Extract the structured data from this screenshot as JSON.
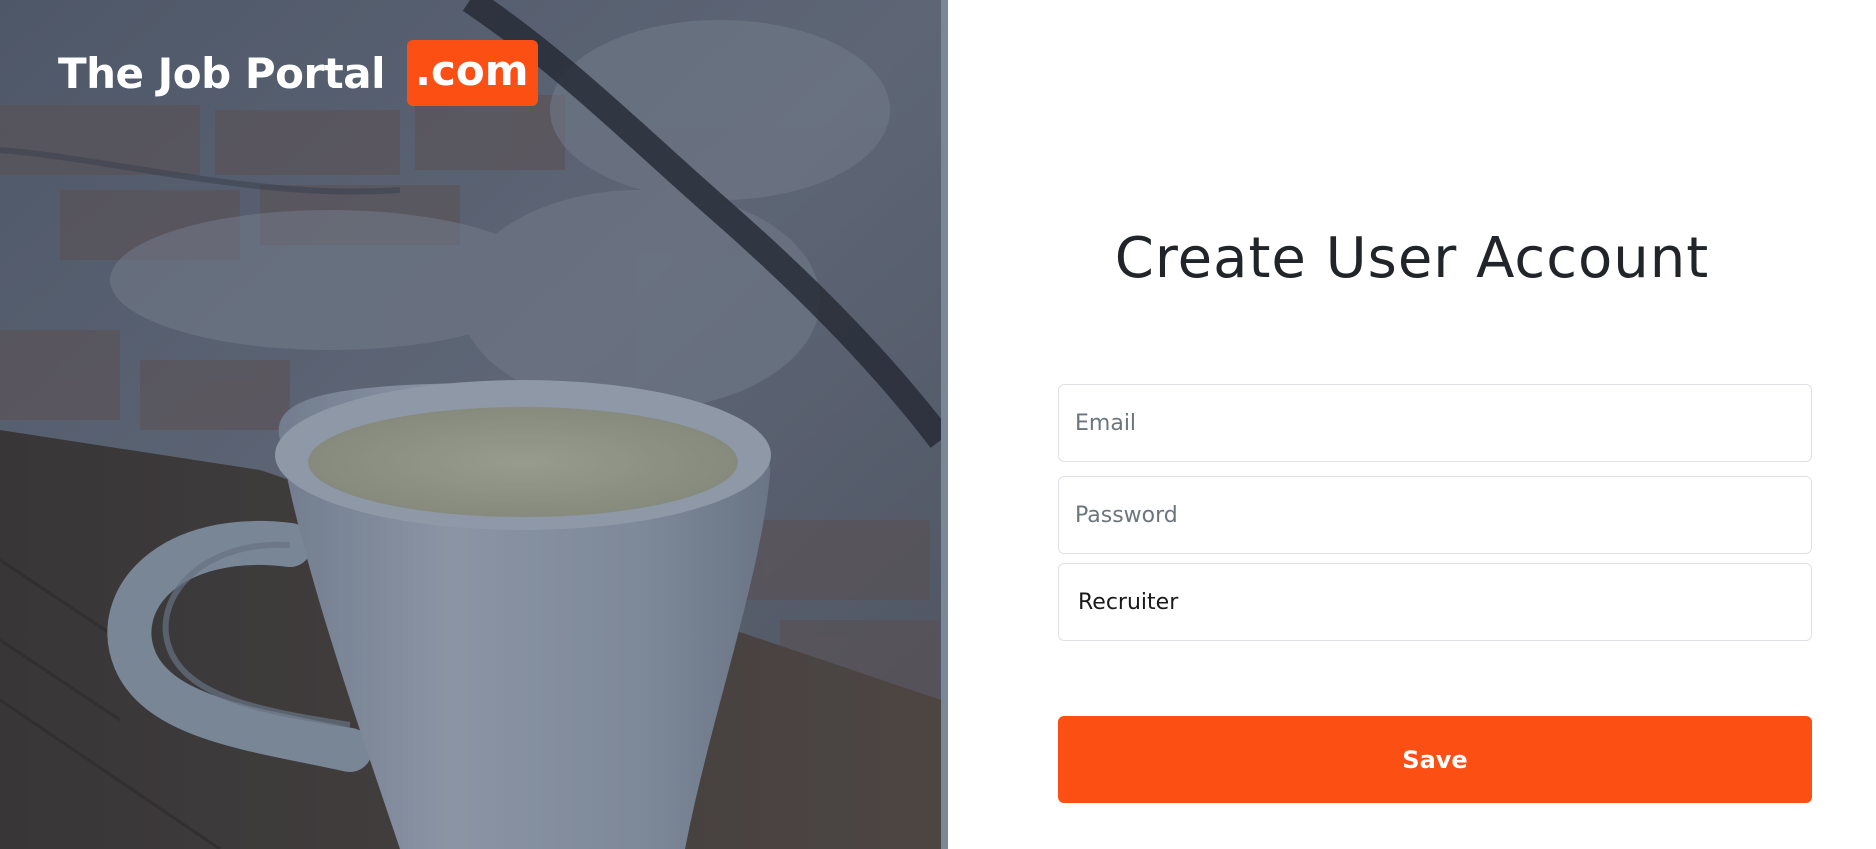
{
  "brand": {
    "name": "The Job Portal",
    "tld": ".com",
    "accent_color": "#fb4f14"
  },
  "hero": {
    "image": "coffee-cup-on-wooden-table-against-brick-wall-photo"
  },
  "form": {
    "title": "Create User Account",
    "email": {
      "placeholder": "Email",
      "value": ""
    },
    "password": {
      "placeholder": "Password",
      "value": ""
    },
    "role": {
      "selected": "Recruiter"
    },
    "save_label": "Save"
  }
}
